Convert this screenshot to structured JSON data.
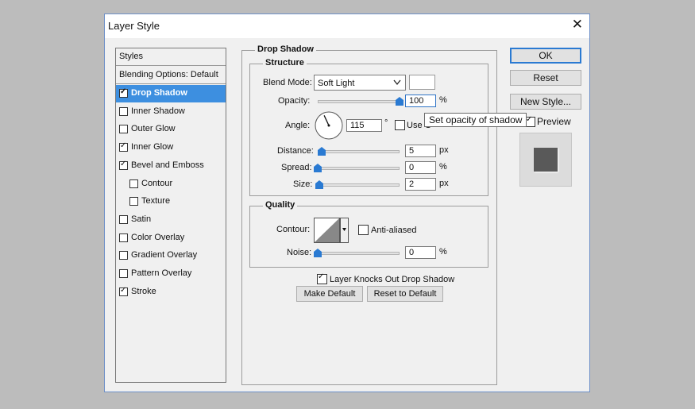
{
  "window": {
    "title": "Layer Style",
    "close_glyph": "✕"
  },
  "styles_panel": {
    "header": "Styles",
    "blending_options": "Blending Options: Default",
    "items": [
      {
        "label": "Drop Shadow",
        "checked": true,
        "selected": true,
        "indent": 0
      },
      {
        "label": "Inner Shadow",
        "checked": false,
        "selected": false,
        "indent": 0
      },
      {
        "label": "Outer Glow",
        "checked": false,
        "selected": false,
        "indent": 0
      },
      {
        "label": "Inner Glow",
        "checked": true,
        "selected": false,
        "indent": 0
      },
      {
        "label": "Bevel and Emboss",
        "checked": true,
        "selected": false,
        "indent": 0
      },
      {
        "label": "Contour",
        "checked": false,
        "selected": false,
        "indent": 1
      },
      {
        "label": "Texture",
        "checked": false,
        "selected": false,
        "indent": 1
      },
      {
        "label": "Satin",
        "checked": false,
        "selected": false,
        "indent": 0
      },
      {
        "label": "Color Overlay",
        "checked": false,
        "selected": false,
        "indent": 0
      },
      {
        "label": "Gradient Overlay",
        "checked": false,
        "selected": false,
        "indent": 0
      },
      {
        "label": "Pattern Overlay",
        "checked": false,
        "selected": false,
        "indent": 0
      },
      {
        "label": "Stroke",
        "checked": true,
        "selected": false,
        "indent": 0
      }
    ]
  },
  "drop_shadow": {
    "section_title": "Drop Shadow",
    "structure": {
      "legend": "Structure",
      "blend_mode_label": "Blend Mode:",
      "blend_mode_value": "Soft Light",
      "shadow_color": "#ffffff",
      "opacity_label": "Opacity:",
      "opacity_value": "100",
      "opacity_unit": "%",
      "opacity_level": 1.0,
      "angle_label": "Angle:",
      "angle_value": "115",
      "angle_unit": "°",
      "use_global_light_label": "Use G",
      "use_global_light_checked": false,
      "distance_label": "Distance:",
      "distance_value": "5",
      "distance_unit": "px",
      "distance_level": 0.05,
      "spread_label": "Spread:",
      "spread_value": "0",
      "spread_unit": "%",
      "spread_level": 0.0,
      "size_label": "Size:",
      "size_value": "2",
      "size_unit": "px",
      "size_level": 0.02
    },
    "quality": {
      "legend": "Quality",
      "contour_label": "Contour:",
      "anti_aliased_label": "Anti-aliased",
      "anti_aliased_checked": false,
      "noise_label": "Noise:",
      "noise_value": "0",
      "noise_unit": "%",
      "noise_level": 0.0
    },
    "layer_knocks_out_label": "Layer Knocks Out Drop Shadow",
    "layer_knocks_out_checked": true,
    "make_default_label": "Make Default",
    "reset_to_default_label": "Reset to Default"
  },
  "buttons": {
    "ok_label": "OK",
    "reset_label": "Reset",
    "new_style_label": "New Style...",
    "preview_label": "Preview",
    "preview_checked": true
  },
  "tooltip": {
    "text": "Set opacity of shadow"
  },
  "colors": {
    "accent": "#3d8fe0",
    "slider_thumb": "#2a7ad2",
    "preview_swatch": "#595959",
    "background": "#bcbcbc"
  }
}
